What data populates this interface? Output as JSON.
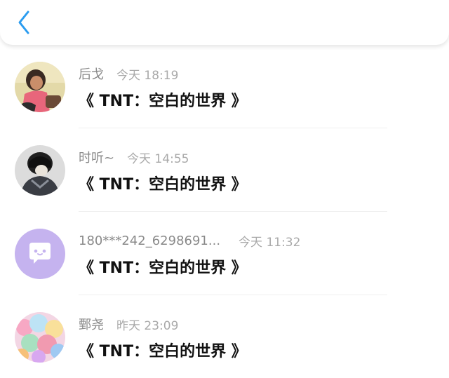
{
  "colors": {
    "accent": "#2b9cf0",
    "name_text": "#8a8a8a",
    "time_text": "#a9a9a9",
    "title_text": "#111111",
    "divider": "#efefef"
  },
  "header": {
    "back_icon": "chevron-left-icon"
  },
  "comments": [
    {
      "name": "后戈",
      "time": "今天 18:19",
      "title": "《 TNT：空白的世界 》",
      "avatar": "girl-photo"
    },
    {
      "name": "时听~",
      "time": "今天 14:55",
      "title": "《 TNT：空白的世界 》",
      "avatar": "hooded-figure-photo"
    },
    {
      "name": "180***242_6298691...",
      "time": "今天 11:32",
      "title": "《 TNT：空白的世界 》",
      "avatar": "default-chat-bubble-icon"
    },
    {
      "name": "鄄尧",
      "time": "昨天 23:09",
      "title": "《 TNT：空白的世界 》",
      "avatar": "colorful-balloons-photo"
    }
  ]
}
